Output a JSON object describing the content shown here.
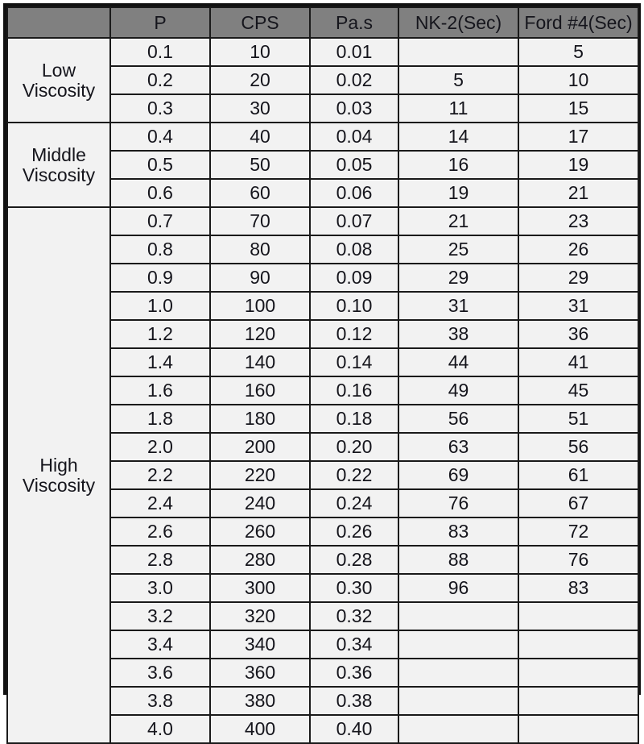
{
  "table": {
    "columns": [
      {
        "key": "group",
        "label": ""
      },
      {
        "key": "p",
        "label": "P"
      },
      {
        "key": "cps",
        "label": "CPS"
      },
      {
        "key": "pas",
        "label": "Pa.s"
      },
      {
        "key": "nk2",
        "label": "NK-2(Sec)"
      },
      {
        "key": "ford",
        "label": "Ford #4(Sec)"
      }
    ],
    "groups": [
      {
        "label": "Low Viscosity",
        "rows": 3
      },
      {
        "label": "Middle Viscosity",
        "rows": 3
      },
      {
        "label": "High Viscosity",
        "rows": 19
      }
    ],
    "rows": [
      {
        "p": "0.1",
        "cps": "10",
        "pas": "0.01",
        "nk2": "",
        "ford": "5"
      },
      {
        "p": "0.2",
        "cps": "20",
        "pas": "0.02",
        "nk2": "5",
        "ford": "10"
      },
      {
        "p": "0.3",
        "cps": "30",
        "pas": "0.03",
        "nk2": "11",
        "ford": "15"
      },
      {
        "p": "0.4",
        "cps": "40",
        "pas": "0.04",
        "nk2": "14",
        "ford": "17"
      },
      {
        "p": "0.5",
        "cps": "50",
        "pas": "0.05",
        "nk2": "16",
        "ford": "19"
      },
      {
        "p": "0.6",
        "cps": "60",
        "pas": "0.06",
        "nk2": "19",
        "ford": "21"
      },
      {
        "p": "0.7",
        "cps": "70",
        "pas": "0.07",
        "nk2": "21",
        "ford": "23"
      },
      {
        "p": "0.8",
        "cps": "80",
        "pas": "0.08",
        "nk2": "25",
        "ford": "26"
      },
      {
        "p": "0.9",
        "cps": "90",
        "pas": "0.09",
        "nk2": "29",
        "ford": "29"
      },
      {
        "p": "1.0",
        "cps": "100",
        "pas": "0.10",
        "nk2": "31",
        "ford": "31"
      },
      {
        "p": "1.2",
        "cps": "120",
        "pas": "0.12",
        "nk2": "38",
        "ford": "36"
      },
      {
        "p": "1.4",
        "cps": "140",
        "pas": "0.14",
        "nk2": "44",
        "ford": "41"
      },
      {
        "p": "1.6",
        "cps": "160",
        "pas": "0.16",
        "nk2": "49",
        "ford": "45"
      },
      {
        "p": "1.8",
        "cps": "180",
        "pas": "0.18",
        "nk2": "56",
        "ford": "51"
      },
      {
        "p": "2.0",
        "cps": "200",
        "pas": "0.20",
        "nk2": "63",
        "ford": "56"
      },
      {
        "p": "2.2",
        "cps": "220",
        "pas": "0.22",
        "nk2": "69",
        "ford": "61"
      },
      {
        "p": "2.4",
        "cps": "240",
        "pas": "0.24",
        "nk2": "76",
        "ford": "67"
      },
      {
        "p": "2.6",
        "cps": "260",
        "pas": "0.26",
        "nk2": "83",
        "ford": "72"
      },
      {
        "p": "2.8",
        "cps": "280",
        "pas": "0.28",
        "nk2": "88",
        "ford": "76"
      },
      {
        "p": "3.0",
        "cps": "300",
        "pas": "0.30",
        "nk2": "96",
        "ford": "83"
      },
      {
        "p": "3.2",
        "cps": "320",
        "pas": "0.32",
        "nk2": "",
        "ford": ""
      },
      {
        "p": "3.4",
        "cps": "340",
        "pas": "0.34",
        "nk2": "",
        "ford": ""
      },
      {
        "p": "3.6",
        "cps": "360",
        "pas": "0.36",
        "nk2": "",
        "ford": ""
      },
      {
        "p": "3.8",
        "cps": "380",
        "pas": "0.38",
        "nk2": "",
        "ford": ""
      },
      {
        "p": "4.0",
        "cps": "400",
        "pas": "0.40",
        "nk2": "",
        "ford": ""
      }
    ]
  },
  "colors": {
    "header_background": "#808080",
    "group_label_background": "#808080",
    "cell_background": "#f2f2f2",
    "border": "#1a1a1a",
    "text": "#15151c"
  },
  "chart_data": {
    "type": "table",
    "title": "",
    "columns": [
      "P",
      "CPS",
      "Pa.s",
      "NK-2(Sec)",
      "Ford #4(Sec)"
    ],
    "row_groups": [
      "Low Viscosity",
      "Middle Viscosity",
      "High Viscosity"
    ],
    "rows": [
      [
        "0.1",
        "10",
        "0.01",
        "",
        "5"
      ],
      [
        "0.2",
        "20",
        "0.02",
        "5",
        "10"
      ],
      [
        "0.3",
        "30",
        "0.03",
        "11",
        "15"
      ],
      [
        "0.4",
        "40",
        "0.04",
        "14",
        "17"
      ],
      [
        "0.5",
        "50",
        "0.05",
        "16",
        "19"
      ],
      [
        "0.6",
        "60",
        "0.06",
        "19",
        "21"
      ],
      [
        "0.7",
        "70",
        "0.07",
        "21",
        "23"
      ],
      [
        "0.8",
        "80",
        "0.08",
        "25",
        "26"
      ],
      [
        "0.9",
        "90",
        "0.09",
        "29",
        "29"
      ],
      [
        "1.0",
        "100",
        "0.10",
        "31",
        "31"
      ],
      [
        "1.2",
        "120",
        "0.12",
        "38",
        "36"
      ],
      [
        "1.4",
        "140",
        "0.14",
        "44",
        "41"
      ],
      [
        "1.6",
        "160",
        "0.16",
        "49",
        "45"
      ],
      [
        "1.8",
        "180",
        "0.18",
        "56",
        "51"
      ],
      [
        "2.0",
        "200",
        "0.20",
        "63",
        "56"
      ],
      [
        "2.2",
        "220",
        "0.22",
        "69",
        "61"
      ],
      [
        "2.4",
        "240",
        "0.24",
        "76",
        "67"
      ],
      [
        "2.6",
        "260",
        "0.26",
        "83",
        "72"
      ],
      [
        "2.8",
        "280",
        "0.28",
        "88",
        "76"
      ],
      [
        "3.0",
        "300",
        "0.30",
        "96",
        "83"
      ],
      [
        "3.2",
        "320",
        "0.32",
        "",
        ""
      ],
      [
        "3.4",
        "340",
        "0.34",
        "",
        ""
      ],
      [
        "3.6",
        "360",
        "0.36",
        "",
        ""
      ],
      [
        "3.8",
        "380",
        "0.38",
        "",
        ""
      ],
      [
        "4.0",
        "400",
        "0.40",
        "",
        ""
      ]
    ]
  }
}
